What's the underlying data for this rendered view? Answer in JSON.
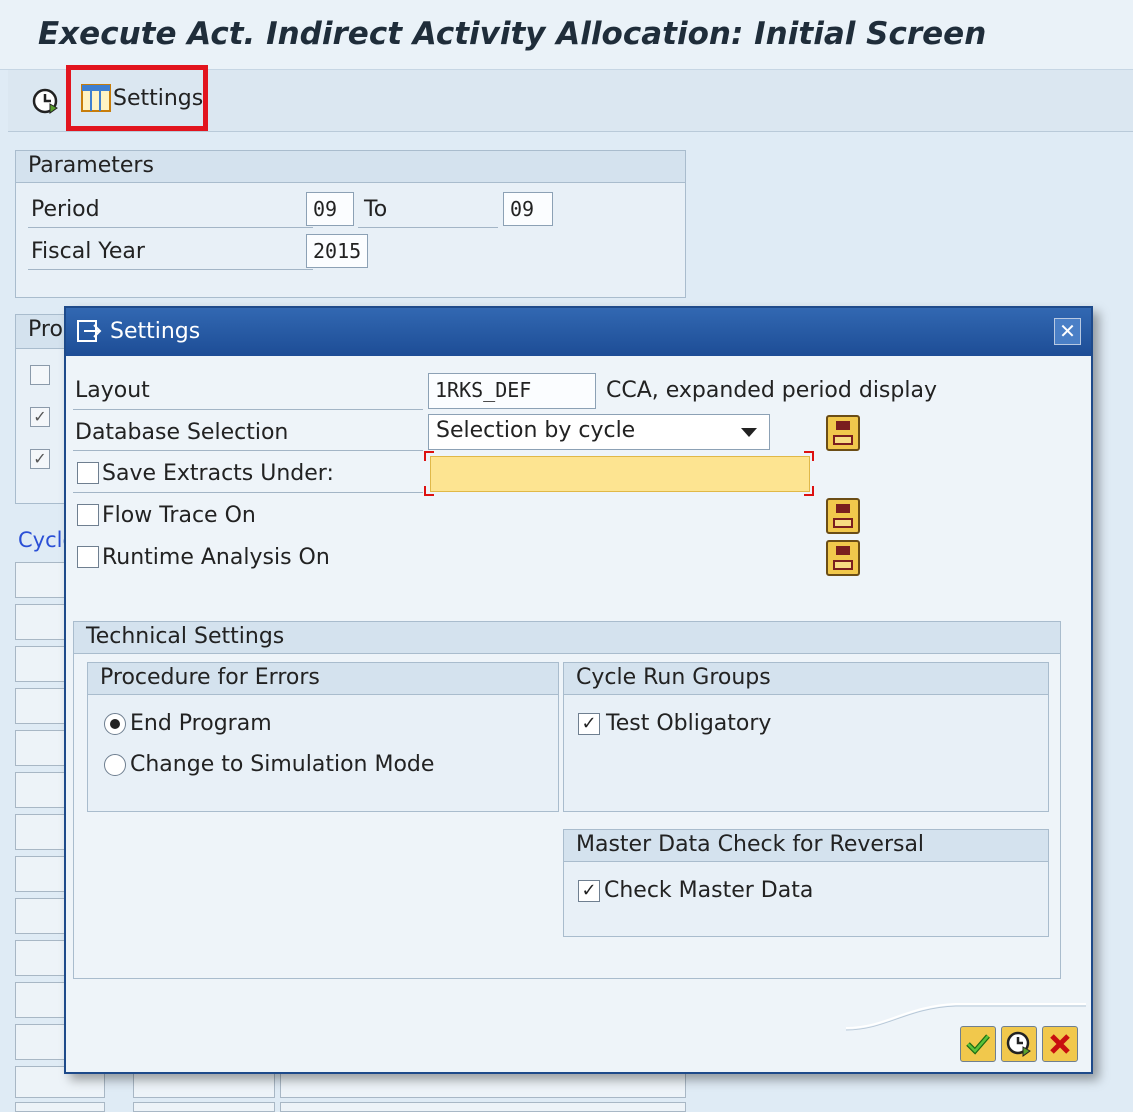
{
  "window": {
    "title": "Execute Act. Indirect Activity Allocation: Initial Screen"
  },
  "toolbar": {
    "settings_label": "Settings"
  },
  "parameters": {
    "header": "Parameters",
    "period_label": "Period",
    "period_from": "09",
    "to_label": "To",
    "period_to": "09",
    "fiscal_year_label": "Fiscal Year",
    "fiscal_year": "2015"
  },
  "background": {
    "processing_header_partial": "Pro",
    "cycle_link_partial": "Cycle"
  },
  "dialog": {
    "title": "Settings",
    "layout_label": "Layout",
    "layout_value": "1RKS_DEF",
    "layout_description": "CCA, expanded period display",
    "db_selection_label": "Database Selection",
    "db_selection_value": "Selection by cycle",
    "save_extracts_label": "Save Extracts Under:",
    "save_extracts_value": "",
    "flow_trace_label": "Flow Trace On",
    "runtime_analysis_label": "Runtime Analysis On",
    "technical": {
      "header": "Technical Settings",
      "errors": {
        "header": "Procedure for Errors",
        "options": [
          "End Program",
          "Change to Simulation Mode"
        ],
        "selected": "End Program"
      },
      "cycle_run_groups": {
        "header": "Cycle Run Groups",
        "test_obligatory_label": "Test Obligatory",
        "test_obligatory_checked": true
      },
      "master_data": {
        "header": "Master Data Check for Reversal",
        "check_label": "Check Master Data",
        "check_checked": true
      }
    }
  },
  "colors": {
    "highlight": "#e2141e",
    "dialog_title": "#1d4d96",
    "required_field": "#fde491"
  },
  "icons": {
    "execute": "execute-icon",
    "settings": "layout-table-icon",
    "save": "save-icon",
    "confirm": "check-icon",
    "cancel": "cancel-icon"
  }
}
